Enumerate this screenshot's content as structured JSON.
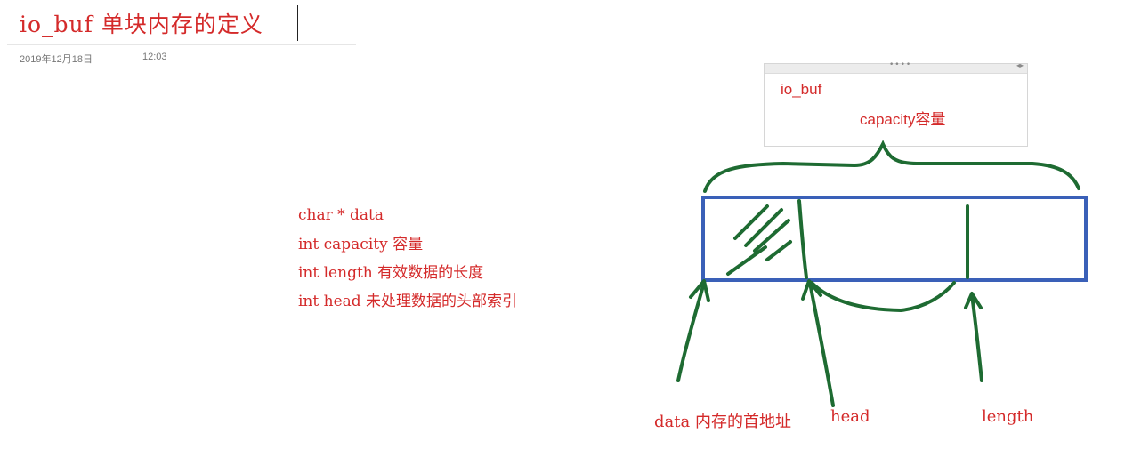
{
  "note": {
    "title": "io_buf 单块内存的定义",
    "date": "2019年12月18日",
    "time": "12:03"
  },
  "popup": {
    "title": "io_buf",
    "subtitle": "capacity容量"
  },
  "fields": [
    "char * data",
    "int capacity 容量",
    "int length  有效数据的长度",
    "int  head  未处理数据的头部索引"
  ],
  "pointer_labels": {
    "data": "data 内存的首地址",
    "head": "head",
    "length": "length"
  },
  "colors": {
    "text_red": "#d42a2a",
    "buffer_blue": "#3a60b8",
    "ink_green": "#1e6b32"
  }
}
